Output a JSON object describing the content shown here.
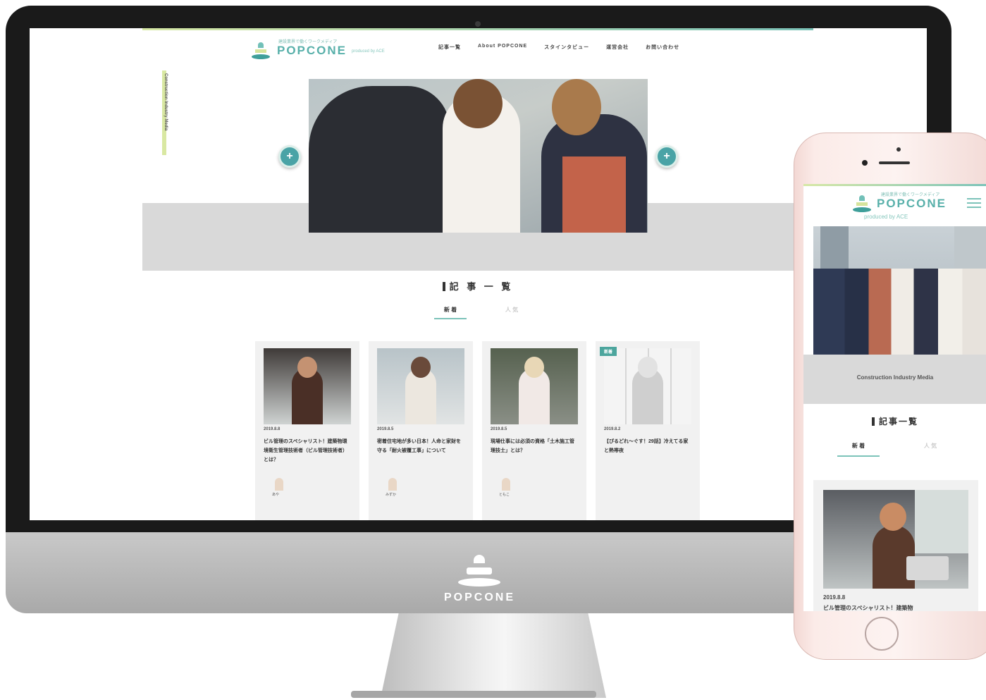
{
  "desktop": {
    "header": {
      "tagline": "建設業界で働くワークメディア",
      "brand": "POPCONE",
      "produced_by": "produced by ACE",
      "nav": [
        "記事一覧",
        "About POPCONE",
        "スタインタビュー",
        "運営会社",
        "お問い合わせ"
      ]
    },
    "side_label": "Construction Industry Media",
    "hero": {
      "prev": "+",
      "next": "+"
    },
    "section_title": "記 事 一 覧",
    "tabs": {
      "active": "新 着",
      "inactive": "人 気"
    },
    "cards": [
      {
        "date": "2019.8.8",
        "title": "ビル管理のスペシャリスト！建築物環境衛生管理技術者（ビル管理技術者）とは？",
        "author": "あや",
        "badge": "",
        "thumb_color": "#6b5a50",
        "figure_color": "#4a2f26"
      },
      {
        "date": "2019.8.5",
        "title": "密着住宅地が多い日本！人命と家財を守る「耐火被覆工事」について",
        "author": "みずか",
        "badge": "",
        "thumb_color": "#c8d0d4",
        "figure_color": "#e9e4dc"
      },
      {
        "date": "2019.8.5",
        "title": "現場仕事には必須の資格「土木施工管理技士」とは？",
        "author": "ともこ",
        "badge": "",
        "thumb_color": "#6b7a68",
        "figure_color": "#f1e9e6"
      },
      {
        "date": "2019.8.2",
        "title": "【ぴるどれ〜ぐす！29話】冷えてる家と熱帯夜",
        "author": "",
        "badge": "新着",
        "thumb_color": "#ededed",
        "figure_color": "#cfcfcf"
      }
    ]
  },
  "chin_logo": "POPCONE",
  "mobile": {
    "header": {
      "tagline": "建設業界で働くワークメディア",
      "brand": "POPCONE",
      "produced_by": "produced by ACE"
    },
    "band_text": "Construction Industry Media",
    "section_title": "記事一覧",
    "tabs": {
      "active": "新 着",
      "inactive": "人 気"
    },
    "card": {
      "date": "2019.8.8",
      "title": "ビル管理のスペシャリスト！建築物"
    }
  }
}
